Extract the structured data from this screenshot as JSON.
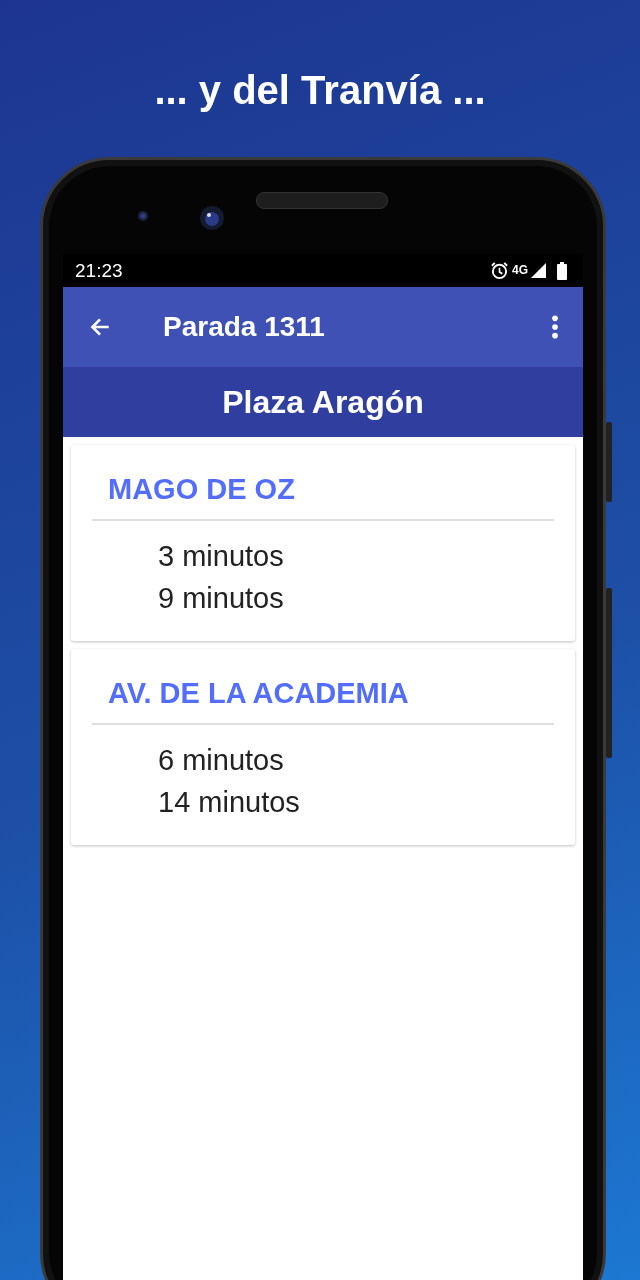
{
  "headline": "... y del Tranvía ...",
  "status_bar": {
    "time": "21:23",
    "network": "4G"
  },
  "app_bar": {
    "title": "Parada 1311"
  },
  "stop_name": "Plaza Aragón",
  "routes": [
    {
      "name": "MAGO DE OZ",
      "arrivals": [
        "3 minutos",
        "9 minutos"
      ]
    },
    {
      "name": "AV. DE LA ACADEMIA",
      "arrivals": [
        "6 minutos",
        "14 minutos"
      ]
    }
  ]
}
